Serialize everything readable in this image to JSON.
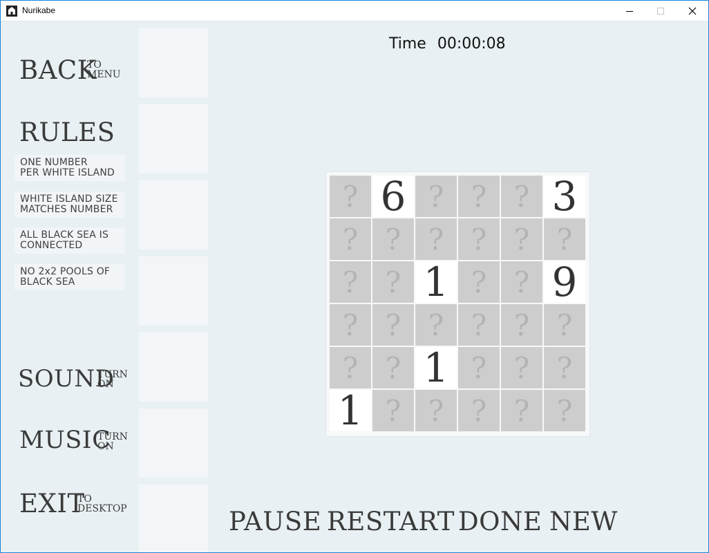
{
  "window": {
    "title": "Nurikabe",
    "icons": {
      "app": "nurikabe-app-icon",
      "minimize": "minimize-icon",
      "maximize": "maximize-icon",
      "close": "close-icon"
    }
  },
  "menu": {
    "back": {
      "word": "BACK",
      "sub1": "TO",
      "sub2": "MENU"
    },
    "rules": {
      "heading": "RULES",
      "items": [
        {
          "line1": "ONE NUMBER",
          "line2": "PER WHITE ISLAND"
        },
        {
          "line1": "WHITE ISLAND SIZE",
          "line2": "MATCHES NUMBER"
        },
        {
          "line1": "ALL BLACK SEA IS",
          "line2": "CONNECTED"
        },
        {
          "line1": "NO 2x2 POOLS OF",
          "line2": "BLACK SEA"
        }
      ]
    },
    "sound": {
      "word": "SOUND",
      "sub1": "TURN",
      "sub2": "ON"
    },
    "music": {
      "word": "MUSIC",
      "sub1": "TURN",
      "sub2": "ON"
    },
    "exit": {
      "word": "EXIT",
      "sub1": "TO",
      "sub2": "DESKTOP"
    }
  },
  "timer": {
    "label": "Time",
    "value": "00:00:08"
  },
  "board": {
    "size": 6,
    "unknown_glyph": "?",
    "rows": [
      [
        "?",
        "6",
        "?",
        "?",
        "?",
        "3"
      ],
      [
        "?",
        "?",
        "?",
        "?",
        "?",
        "?"
      ],
      [
        "?",
        "?",
        "1",
        "?",
        "?",
        "9"
      ],
      [
        "?",
        "?",
        "?",
        "?",
        "?",
        "?"
      ],
      [
        "?",
        "?",
        "1",
        "?",
        "?",
        "?"
      ],
      [
        "1",
        "?",
        "?",
        "?",
        "?",
        "?"
      ]
    ]
  },
  "actions": {
    "pause": "PAUSE",
    "restart": "RESTART",
    "done": "DONE",
    "new": "NEW"
  },
  "colors": {
    "background": "#e8f0f3",
    "unknown_cell": "#cdcdcd",
    "number_cell": "#ffffff",
    "window_border": "#1883d7"
  }
}
